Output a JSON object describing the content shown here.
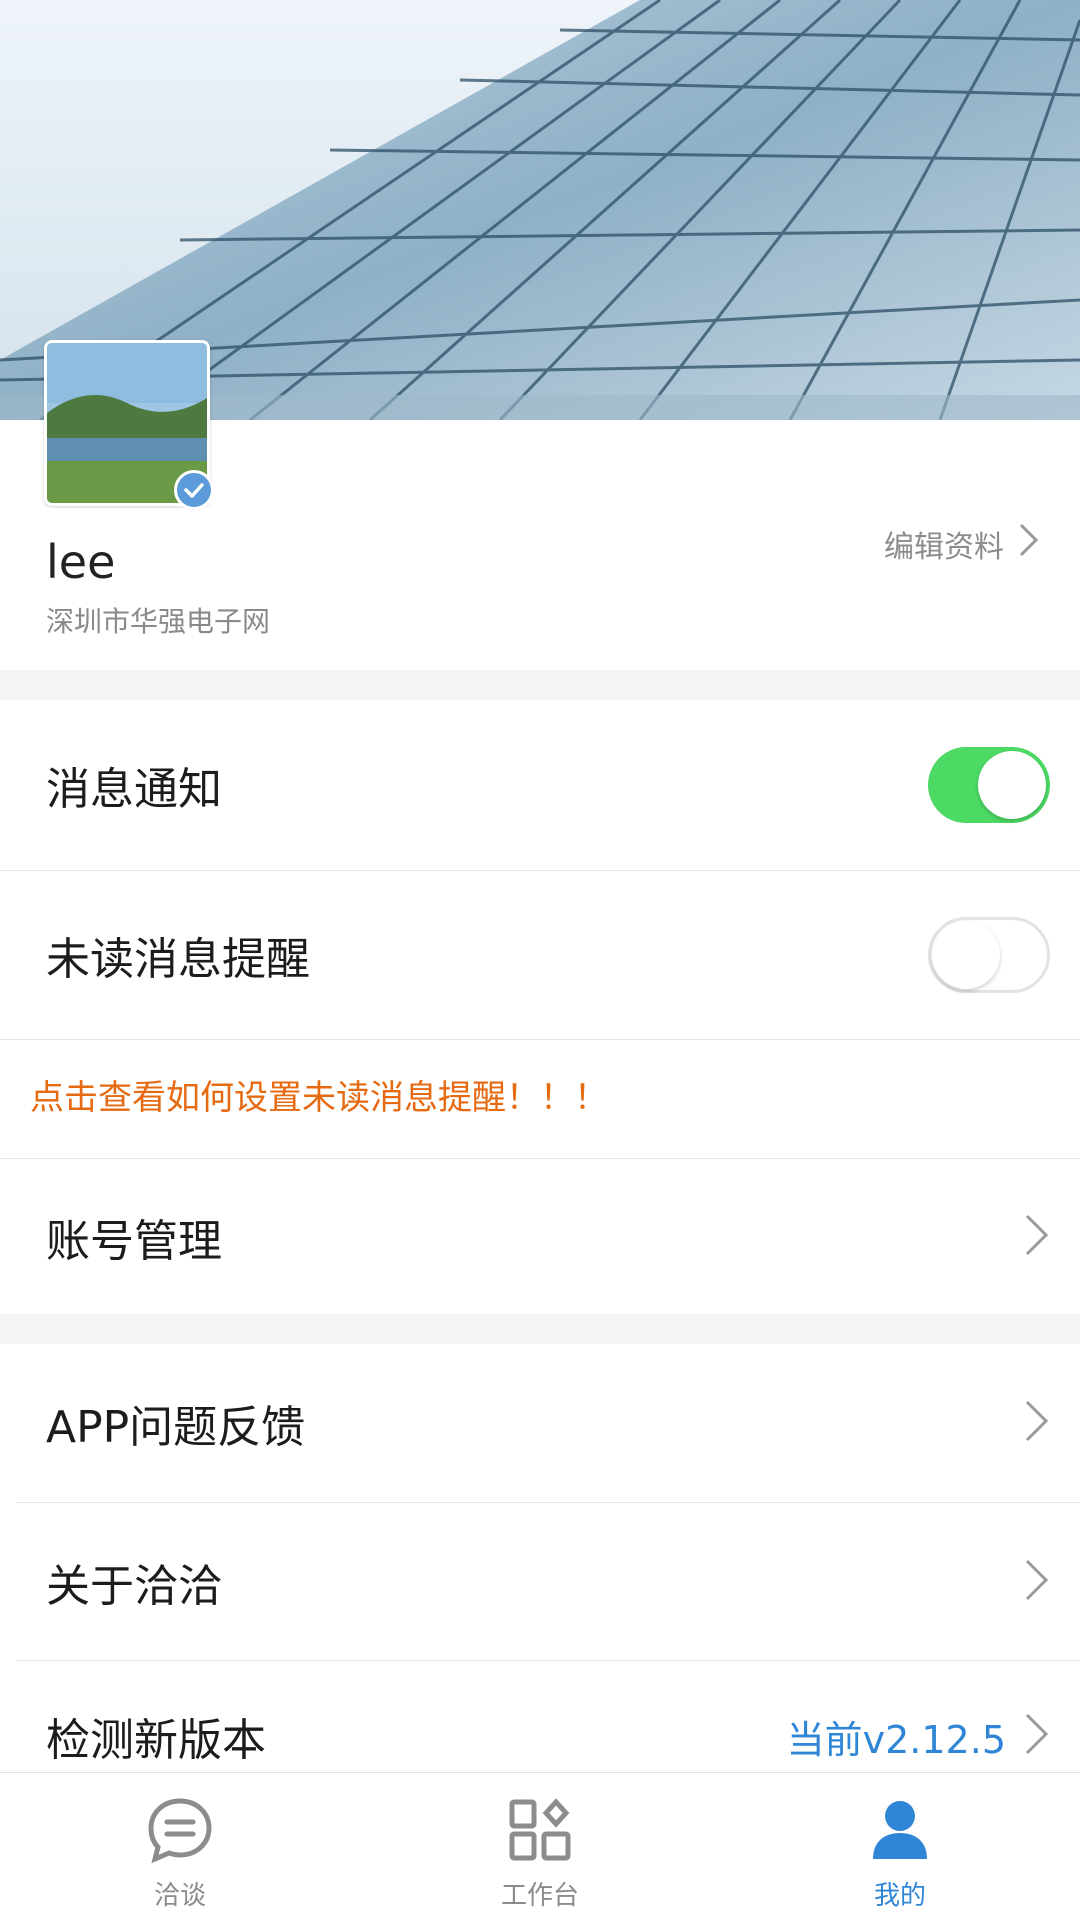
{
  "profile": {
    "username": "lee",
    "company": "深圳市华强电子网",
    "edit_label": "编辑资料"
  },
  "settings": {
    "message_notify": {
      "label": "消息通知",
      "enabled": true
    },
    "unread_reminder": {
      "label": "未读消息提醒",
      "enabled": false
    },
    "hint_link": "点击查看如何设置未读消息提醒！！！",
    "account_manage": {
      "label": "账号管理"
    },
    "feedback": {
      "label": "APP问题反馈"
    },
    "about": {
      "label": "关于洽洽"
    },
    "check_update": {
      "label": "检测新版本",
      "value": "当前v2.12.5"
    }
  },
  "tabbar": {
    "tabs": [
      {
        "label": "洽谈",
        "icon": "chat-icon",
        "active": false
      },
      {
        "label": "工作台",
        "icon": "workbench-icon",
        "active": false
      },
      {
        "label": "我的",
        "icon": "user-icon",
        "active": true
      }
    ]
  },
  "colors": {
    "accent": "#2f86d6",
    "toggle_on": "#4cd964",
    "hint": "#e66a12"
  }
}
